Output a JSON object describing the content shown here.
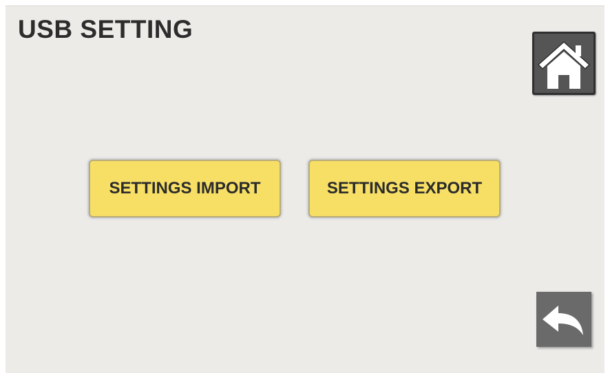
{
  "header": {
    "title": "USB SETTING"
  },
  "actions": {
    "import_label": "SETTINGS IMPORT",
    "export_label": "SETTINGS EXPORT"
  },
  "navigation": {
    "home_icon": "home-icon",
    "back_icon": "back-arrow-icon"
  },
  "colors": {
    "background": "#edebe8",
    "action_button": "#f7df66",
    "nav_button": "#555555",
    "text": "#2c2c2c"
  }
}
